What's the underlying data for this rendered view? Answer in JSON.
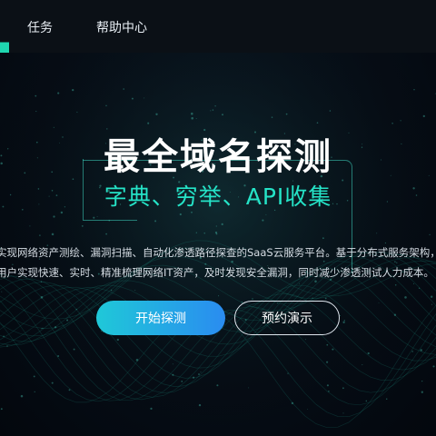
{
  "nav": {
    "items": [
      {
        "label": "任务"
      },
      {
        "label": "帮助中心"
      }
    ],
    "accent_color": "#1fd6b0"
  },
  "hero": {
    "title": "最全域名探测",
    "subtitle": "字典、穷举、API收集",
    "description": [
      "实现网络资产测绘、漏洞扫描、自动化渗透路径探查的SaaS云服务平台。基于分布式服务架构，",
      "用户实现快速、实时、精准梳理网络IT资产，及时发现安全漏洞，同时减少渗透测试人力成本。"
    ],
    "buttons": {
      "start": "开始探测",
      "demo": "预约演示"
    },
    "colors": {
      "subtitle": "#25e3c7",
      "button_gradient_start": "#1fc8d8",
      "button_gradient_end": "#2a8cf0",
      "background": "#050b14"
    }
  }
}
